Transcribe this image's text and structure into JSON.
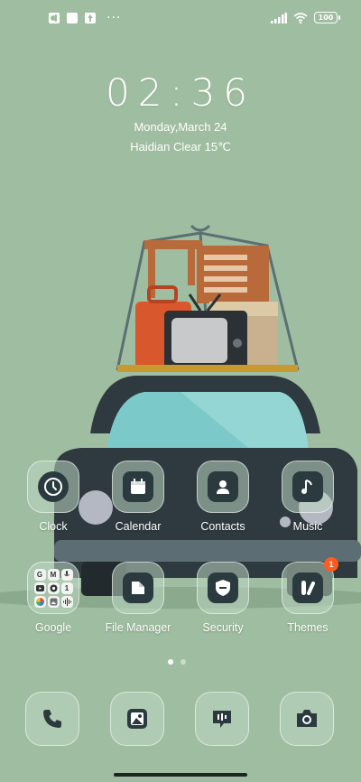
{
  "status_bar": {
    "notification_icons": [
      "app-notification-icon",
      "square-notification-icon",
      "upload-notification-icon"
    ],
    "more_indicator": "···",
    "battery": "100",
    "signal_icon": "signal-bars-icon",
    "wifi_icon": "wifi-icon"
  },
  "clock_widget": {
    "time": "02:36",
    "date": "Monday,March 24",
    "weather": "Haidian Clear 15℃"
  },
  "home_apps": [
    {
      "label": "Clock",
      "icon": "clock-icon"
    },
    {
      "label": "Calendar",
      "icon": "calendar-icon"
    },
    {
      "label": "Contacts",
      "icon": "person-icon"
    },
    {
      "label": "Music",
      "icon": "music-note-icon"
    },
    {
      "label": "Google",
      "icon": "google-folder-icon"
    },
    {
      "label": "File Manager",
      "icon": "folder-icon"
    },
    {
      "label": "Security",
      "icon": "shield-icon"
    },
    {
      "label": "Themes",
      "icon": "themes-brush-icon",
      "badge": "1"
    }
  ],
  "google_folder": {
    "mini_icons": [
      "G",
      "M",
      "🎤",
      "▶",
      "◉",
      "1",
      "✦",
      "▣",
      "⁞"
    ]
  },
  "page_indicator": {
    "pages": 2,
    "current": 1
  },
  "dock": [
    {
      "icon": "phone-icon"
    },
    {
      "icon": "gallery-icon"
    },
    {
      "icon": "voice-message-icon"
    },
    {
      "icon": "camera-icon"
    }
  ],
  "colors": {
    "wallpaper": "#9fbda0",
    "badge": "#ff5a1f",
    "icon_glyph": "#2b3a3e"
  }
}
